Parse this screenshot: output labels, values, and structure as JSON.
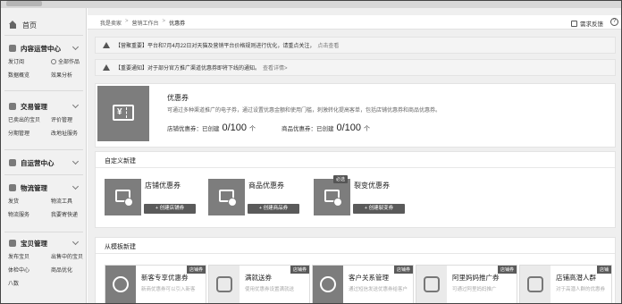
{
  "sidebar": {
    "home": "首页",
    "sections": [
      {
        "title": "内容运营中心",
        "items": [
          "发订阅",
          "全部作品",
          "数据概览",
          "效果分析"
        ]
      },
      {
        "title": "交易管理",
        "items": [
          "已卖出的宝贝",
          "评价管理",
          "分期管理",
          "改地址服务"
        ]
      },
      {
        "title": "自运营中心",
        "items": []
      },
      {
        "title": "物流管理",
        "items": [
          "发货",
          "物流工具",
          "物流服务",
          "我要寄快递"
        ]
      },
      {
        "title": "宝贝管理",
        "items": [
          "发布宝贝",
          "出售中的宝贝",
          "体检中心",
          "商品优化",
          "八数"
        ]
      }
    ]
  },
  "breadcrumb": {
    "items": [
      "我是卖家",
      "营销工作台",
      "优惠券"
    ]
  },
  "header": {
    "feedback": "需求反馈",
    "help": "?"
  },
  "notices": [
    {
      "text": "【营聚重要】平台和7月4月22日对天猫及营销平台价格规则进行优化，请重点关注，",
      "link": "点击查看"
    },
    {
      "text": "【重要通知】对于部分官方推广渠道优惠券即将下线的通知。",
      "link": "查看详情>"
    }
  ],
  "overview": {
    "title": "优惠券",
    "desc": "可通过多种渠道推广的电子券，通过设置优惠金额和使用门槛，刺激转化提高客单，包括店铺优惠券和商品优惠券。",
    "stats": [
      {
        "label": "店铺优惠券：已创建",
        "value": "0/100",
        "unit": "个"
      },
      {
        "label": "商品优惠券：已创建",
        "value": "0/100",
        "unit": "个"
      }
    ]
  },
  "custom": {
    "title": "自定义新建",
    "cards": [
      {
        "name": "店铺优惠券",
        "button": "+ 创建店铺券",
        "tag": ""
      },
      {
        "name": "商品优惠券",
        "button": "+ 创建商品券",
        "tag": ""
      },
      {
        "name": "裂变优惠券",
        "button": "+ 创建裂变券",
        "tag": "必选"
      }
    ]
  },
  "template": {
    "title": "从模板新建",
    "cards": [
      {
        "name": "新客专享优惠券",
        "desc": "新商优惠券可以引入新客",
        "badge": "店铺券"
      },
      {
        "name": "满就送券",
        "desc": "使用优惠券设置满就送",
        "badge": "店铺券"
      },
      {
        "name": "客户关系管理",
        "desc": "通过短信发送优惠券给客户",
        "badge": "店铺券"
      },
      {
        "name": "阿里妈妈推广券",
        "desc": "可通过阿里妈妈推广",
        "badge": "店铺券"
      },
      {
        "name": "店铺高潜人群",
        "desc": "对于高潜人群的优惠券",
        "badge": "店铺"
      }
    ]
  },
  "colors": {
    "sidebar_bg": "#f1f1f1",
    "icon_gray": "#7d7d7d",
    "button_dark": "#5a5a5a"
  }
}
